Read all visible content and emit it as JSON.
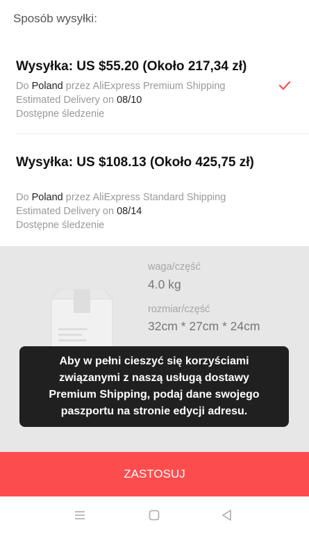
{
  "header": {
    "title": "Sposób wysyłki:"
  },
  "options": [
    {
      "title": "Wysyłka: US $55.20 (Około 217,34 zł)",
      "to_prefix": "Do",
      "country": "Poland",
      "via": "przez AliExpress Premium Shipping",
      "delivery_label": "Estimated Delivery on",
      "delivery_date": "08/10",
      "tracking": "Dostępne śledzenie",
      "selected": true
    },
    {
      "title": "Wysyłka: US $108.13 (Około 425,75 zł)",
      "to_prefix": "Do",
      "country": "Poland",
      "via": "przez AliExpress Standard Shipping",
      "delivery_label": "Estimated Delivery on",
      "delivery_date": "08/14",
      "tracking": "Dostępne śledzenie",
      "selected": false
    }
  ],
  "package": {
    "weight_label": "waga/część",
    "weight_value": "4.0 kg",
    "size_label": "rozmiar/część",
    "size_value": "32cm * 27cm * 24cm"
  },
  "toast": {
    "message": "Aby w pełni cieszyć się korzyściami związanymi z naszą usługą dostawy Premium Shipping, podaj dane swojego paszportu na stronie edycji adresu."
  },
  "apply_button": {
    "label": "ZASTOSUJ"
  },
  "colors": {
    "accent": "#fd4c4d",
    "toast_bg": "#202020",
    "panel_bg": "#e7e7e7"
  },
  "nav": {
    "icons": [
      "menu-icon",
      "home-icon",
      "back-icon"
    ]
  }
}
